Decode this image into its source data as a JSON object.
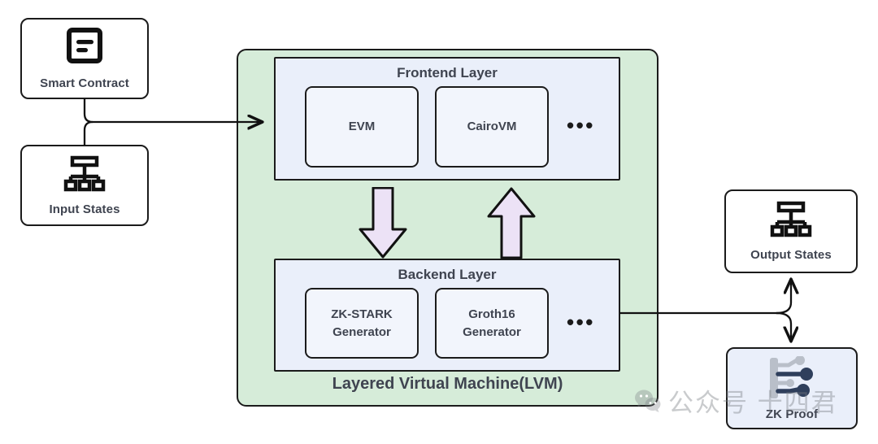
{
  "diagram": {
    "title": "Layered Virtual Machine(LVM)",
    "colors": {
      "container_fill": "#d6ecd9",
      "panel_fill": "#eaeffa",
      "item_fill": "#f2f5fc",
      "arrow_fill": "#ece2f6",
      "stroke": "#1b1b1b",
      "text": "#3f4450",
      "zk_node_fill": "#eaeffa",
      "zk_icon_dark": "#2f3f5c",
      "zk_icon_light": "#b9bfc9"
    }
  },
  "inputs": [
    {
      "id": "smart-contract",
      "label": "Smart Contract",
      "icon": "contract-icon"
    },
    {
      "id": "input-states",
      "label": "Input States",
      "icon": "hierarchy-icon"
    }
  ],
  "outputs": [
    {
      "id": "output-states",
      "label": "Output States",
      "icon": "hierarchy-icon"
    },
    {
      "id": "zk-proof",
      "label": "ZK Proof",
      "icon": "circuit-icon"
    }
  ],
  "layers": [
    {
      "id": "frontend-layer",
      "title": "Frontend Layer",
      "items": [
        {
          "label": "EVM"
        },
        {
          "label": "CairoVM"
        }
      ],
      "more": "•••"
    },
    {
      "id": "backend-layer",
      "title": "Backend Layer",
      "items": [
        {
          "line1": "ZK-STARK",
          "line2": "Generator"
        },
        {
          "line1": "Groth16",
          "line2": "Generator"
        }
      ],
      "more": "•••"
    }
  ],
  "flow_arrows": [
    {
      "id": "frontend-to-backend",
      "direction": "down",
      "color": "#ece2f6"
    },
    {
      "id": "backend-to-frontend",
      "direction": "up",
      "color": "#ece2f6"
    }
  ],
  "watermark": {
    "text": "公众号 十四君",
    "icon": "wechat-icon"
  }
}
